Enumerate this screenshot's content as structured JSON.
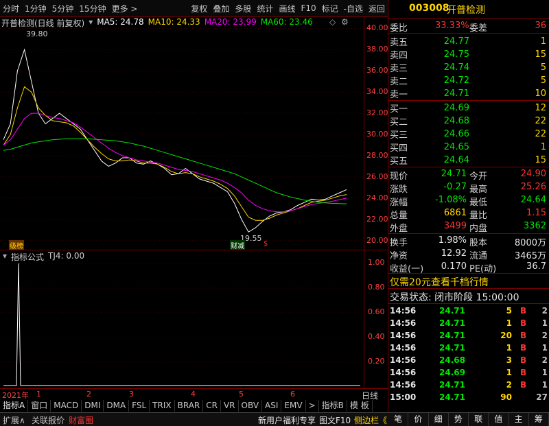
{
  "toolbar": {
    "left_items": [
      "分时",
      "1分钟",
      "5分钟",
      "15分钟",
      "更多 >"
    ],
    "right_items": [
      "复权",
      "叠加",
      "多股",
      "统计",
      "画线",
      "F10",
      "标记",
      "-自选",
      "返回"
    ]
  },
  "chart_header": {
    "name": "开普检测(日线 前复权)",
    "ma5": "MA5: 24.78",
    "ma10": "MA10: 24.33",
    "ma20": "MA20: 23.99",
    "ma60": "MA60: 23.46"
  },
  "annotations": {
    "high": "39.80",
    "low": "19.55",
    "tag1": "级榜",
    "tag2": "财减",
    "tag3": "$"
  },
  "indicator_header": {
    "name": "指标公式",
    "value": "TJ4: 0.00"
  },
  "indicator_axis": [
    "1.00",
    "0.80",
    "0.60",
    "0.40",
    "0.20"
  ],
  "time_axis": {
    "year": "2021年",
    "months": [
      "1",
      "2",
      "3",
      "4",
      "5",
      "6"
    ],
    "period": "日线"
  },
  "bottom_tabs": [
    "指标A",
    "窗口",
    "MACD",
    "DMI",
    "DMA",
    "FSL",
    "TRIX",
    "BRAR",
    "CR",
    "VR",
    "OBV",
    "ASI",
    "EMV",
    ">",
    "指标B",
    "模 板"
  ],
  "status_bar": {
    "left": [
      "扩展∧",
      "关联报价",
      "财富圈"
    ],
    "right": [
      "新用户福利专享",
      "图文F10",
      "侧边栏《"
    ],
    "side_tabs": [
      "笔",
      "价",
      "细",
      "势",
      "联",
      "值",
      "主",
      "筹"
    ]
  },
  "quote": {
    "code": "003008",
    "name": "开普检测",
    "weibi_label": "委比",
    "weibi": "33.33%",
    "weicha_label": "委差",
    "weicha": "36",
    "sells": [
      {
        "label": "卖五",
        "price": "24.77",
        "vol": "1"
      },
      {
        "label": "卖四",
        "price": "24.75",
        "vol": "15"
      },
      {
        "label": "卖三",
        "price": "24.74",
        "vol": "5"
      },
      {
        "label": "卖二",
        "price": "24.72",
        "vol": "5"
      },
      {
        "label": "卖一",
        "price": "24.71",
        "vol": "10"
      }
    ],
    "buys": [
      {
        "label": "买一",
        "price": "24.69",
        "vol": "12"
      },
      {
        "label": "买二",
        "price": "24.68",
        "vol": "22"
      },
      {
        "label": "买三",
        "price": "24.66",
        "vol": "22"
      },
      {
        "label": "买四",
        "price": "24.65",
        "vol": "1"
      },
      {
        "label": "买五",
        "price": "24.64",
        "vol": "15"
      }
    ],
    "stats": [
      {
        "l1": "现价",
        "v1": "24.71",
        "l2": "今开",
        "v2": "24.90"
      },
      {
        "l1": "涨跌",
        "v1": "-0.27",
        "l2": "最高",
        "v2": "25.26"
      },
      {
        "l1": "涨幅",
        "v1": "-1.08%",
        "l2": "最低",
        "v2": "24.64"
      },
      {
        "l1": "总量",
        "v1": "6861",
        "l2": "量比",
        "v2": "1.15"
      },
      {
        "l1": "外盘",
        "v1": "3499",
        "l2": "内盘",
        "v2": "3362"
      }
    ],
    "stats2": [
      {
        "l1": "换手",
        "v1": "1.98%",
        "l2": "股本",
        "v2": "8000万"
      },
      {
        "l1": "净资",
        "v1": "12.92",
        "l2": "流通",
        "v2": "3465万"
      },
      {
        "l1": "收益(一)",
        "v1": "0.170",
        "l2": "PE(动)",
        "v2": "36.7"
      }
    ],
    "promo": "仅需20元查看千档行情",
    "trade_status": "交易状态: 闭市阶段 15:00:00",
    "ticks": [
      {
        "t": "14:56",
        "p": "24.71",
        "v": "5",
        "d": "B",
        "n": "2"
      },
      {
        "t": "14:56",
        "p": "24.71",
        "v": "1",
        "d": "B",
        "n": "1"
      },
      {
        "t": "14:56",
        "p": "24.71",
        "v": "20",
        "d": "B",
        "n": "2"
      },
      {
        "t": "14:56",
        "p": "24.71",
        "v": "1",
        "d": "B",
        "n": "1"
      },
      {
        "t": "14:56",
        "p": "24.68",
        "v": "3",
        "d": "B",
        "n": "2"
      },
      {
        "t": "14:56",
        "p": "24.69",
        "v": "1",
        "d": "B",
        "n": "1"
      },
      {
        "t": "14:56",
        "p": "24.71",
        "v": "2",
        "d": "B",
        "n": "1"
      },
      {
        "t": "15:00",
        "p": "24.71",
        "v": "90",
        "d": "",
        "n": "27"
      }
    ]
  },
  "chart_data": {
    "type": "line",
    "title": "开普检测(日线 前复权)",
    "ylim": [
      19,
      41
    ],
    "yticks": [
      40,
      38,
      36,
      34,
      32,
      30,
      28,
      26,
      24,
      22,
      20
    ],
    "ytick_labels": [
      "40.00",
      "38.00",
      "36.00",
      "34.00",
      "32.00",
      "30.00",
      "28.00",
      "26.00",
      "24.00",
      "22.00",
      "20.00"
    ],
    "series": [
      {
        "name": "MA5",
        "color": "#ffffff",
        "values": [
          29.5,
          31,
          36,
          38,
          35,
          32,
          31,
          31.5,
          32,
          31.5,
          31,
          30.5,
          29.5,
          28.5,
          27.5,
          27,
          27.3,
          27.8,
          27.8,
          27.3,
          27.2,
          27.5,
          27.2,
          26.8,
          26.2,
          26.3,
          26.8,
          26.3,
          25.8,
          25.6,
          25.4,
          25.0,
          24.6,
          23.5,
          22.0,
          20.8,
          21.2,
          21.8,
          22.3,
          22.6,
          22.7,
          22.9,
          23.3,
          23.6,
          23.9,
          23.8,
          23.9,
          24.2,
          24.5,
          24.8
        ]
      },
      {
        "name": "MA10",
        "color": "#ffd700",
        "values": [
          29,
          30,
          32.5,
          34.5,
          34,
          32.5,
          31.8,
          31.3,
          31.2,
          31.1,
          30.8,
          30.2,
          29.5,
          28.8,
          28.2,
          27.7,
          27.5,
          27.5,
          27.6,
          27.5,
          27.3,
          27.3,
          27.2,
          26.9,
          26.5,
          26.3,
          26.4,
          26.3,
          26.0,
          25.8,
          25.6,
          25.3,
          24.9,
          24.2,
          23.2,
          22.2,
          21.9,
          21.9,
          22.1,
          22.4,
          22.6,
          22.8,
          23.0,
          23.3,
          23.6,
          23.7,
          23.8,
          24.0,
          24.2,
          24.33
        ]
      },
      {
        "name": "MA20",
        "color": "#ff00ff",
        "values": [
          29,
          29.5,
          30.5,
          31.5,
          32,
          32,
          31.8,
          31.6,
          31.5,
          31.3,
          31.1,
          30.7,
          30.2,
          29.7,
          29.2,
          28.7,
          28.3,
          28.0,
          27.8,
          27.6,
          27.5,
          27.4,
          27.3,
          27.1,
          26.9,
          26.7,
          26.6,
          26.5,
          26.3,
          26.1,
          25.9,
          25.7,
          25.4,
          25.0,
          24.5,
          23.8,
          23.3,
          23.0,
          22.8,
          22.7,
          22.7,
          22.8,
          23.0,
          23.2,
          23.4,
          23.5,
          23.6,
          23.7,
          23.85,
          23.99
        ]
      },
      {
        "name": "MA60",
        "color": "#00e600",
        "values": [
          28.5,
          28.6,
          28.8,
          29.0,
          29.2,
          29.3,
          29.4,
          29.5,
          29.55,
          29.6,
          29.6,
          29.6,
          29.6,
          29.55,
          29.5,
          29.45,
          29.4,
          29.3,
          29.2,
          29.05,
          28.9,
          28.7,
          28.5,
          28.3,
          28.1,
          27.9,
          27.7,
          27.5,
          27.3,
          27.1,
          26.9,
          26.7,
          26.5,
          26.3,
          26.0,
          25.7,
          25.4,
          25.1,
          24.8,
          24.5,
          24.3,
          24.1,
          23.95,
          23.8,
          23.7,
          23.6,
          23.55,
          23.5,
          23.48,
          23.46
        ]
      }
    ]
  }
}
